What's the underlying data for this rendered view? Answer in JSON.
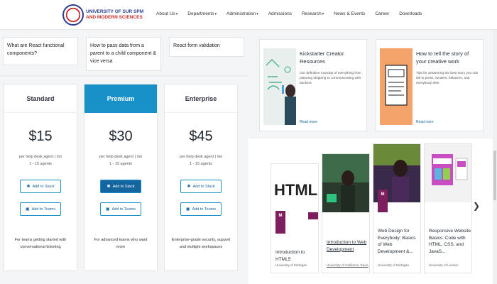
{
  "header": {
    "logo_line1": "UNIVERSITY OF SUR SPM",
    "logo_line2": "AND MODERN SCIENCES",
    "menu": [
      {
        "label": "About Us",
        "dropdown": true
      },
      {
        "label": "Departments",
        "dropdown": true
      },
      {
        "label": "Administration",
        "dropdown": true
      },
      {
        "label": "Admissions",
        "dropdown": false
      },
      {
        "label": "Research",
        "dropdown": true
      },
      {
        "label": "News & Events",
        "dropdown": false
      },
      {
        "label": "Career",
        "dropdown": false
      },
      {
        "label": "Downloads",
        "dropdown": false
      }
    ]
  },
  "faq": [
    "What are React functional components?",
    "How to pass data from a parent to a child component & vice versa",
    "React form validation"
  ],
  "pricing": [
    {
      "name": "Standard",
      "price": "$15",
      "per_line1": "per help desk agent | mo",
      "per_line2": "1 - 15 agents",
      "slack": "Add to Slack",
      "teams": "Add to Teams",
      "note": "For teams getting started with conversational ticketing"
    },
    {
      "name": "Premium",
      "price": "$30",
      "per_line1": "per help desk agent | mo",
      "per_line2": "1 - 15 agents",
      "slack": "Add to Slack",
      "teams": "Add to Teams",
      "note": "For advanced teams who want more"
    },
    {
      "name": "Enterprise",
      "price": "$45",
      "per_line1": "per help desk agent | mo",
      "per_line2": "1 - 15 agents",
      "slack": "Add to Slack",
      "teams": "Add to Teams",
      "note": "Enterprise-grade security, support and multiple workspaces"
    }
  ],
  "resources": [
    {
      "title": "Kickstarter Creator Resources",
      "desc": "Our definitive roundup of everything from planning shipping to communicating with backers.",
      "more": "Read more"
    },
    {
      "title": "How to tell the story of your creative work",
      "desc": "Tips for answering the best story you can tell to press, funders, followers, and everybody else.",
      "more": "Read more"
    }
  ],
  "courses": [
    {
      "title": "Introduction to HTML5",
      "university": "University of Michigan",
      "underline": false
    },
    {
      "title": "Introduction to Web Development",
      "university": "University of California, Davis",
      "underline": true
    },
    {
      "title": "Web Design for Everybody: Basics of Web Development &...",
      "university": "University of Michigan",
      "underline": false
    },
    {
      "title": "Responsive Website Basics: Code with HTML, CSS, and JavaS...",
      "university": "University of London",
      "underline": false
    }
  ],
  "course_img_text": {
    "html": "HTML",
    "badge": "M"
  },
  "colors": {
    "accent": "#1791c8",
    "brand_blue": "#2b3e8f",
    "brand_red": "#c92a2a",
    "badge": "#7d1f5f"
  }
}
